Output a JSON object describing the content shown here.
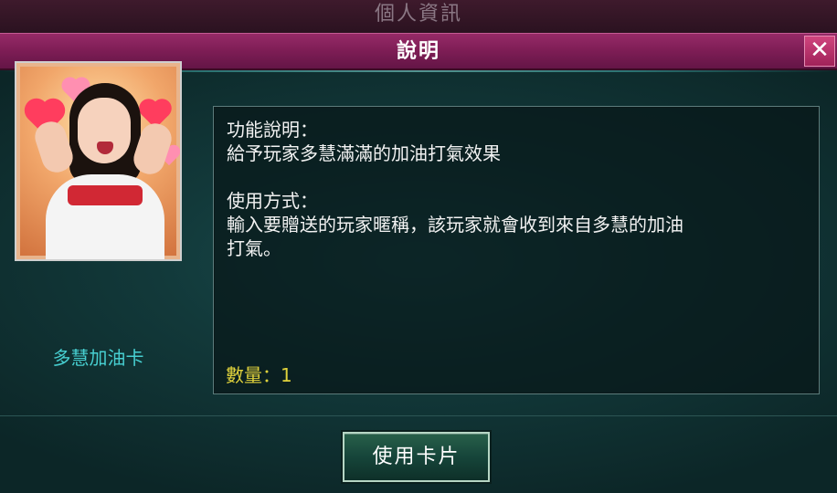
{
  "background_window": {
    "title": "個人資訊"
  },
  "dialog": {
    "title": "說明",
    "close_label": "✕"
  },
  "card": {
    "name": "多慧加油卡",
    "image_icon": "cheer-card-portrait"
  },
  "description": {
    "function_heading": "功能說明：",
    "function_text": "給予玩家多慧滿滿的加油打氣效果",
    "usage_heading": "使用方式：",
    "usage_line1": "輸入要贈送的玩家暱稱，該玩家就會收到來自多慧的加油",
    "usage_line2": "打氣。",
    "quantity": "數量：1"
  },
  "footer": {
    "use_button_label": "使用卡片"
  },
  "colors": {
    "header": "#7d1d55",
    "card_name": "#47cfd1",
    "quantity": "#e0d23c",
    "button": "#16453a"
  }
}
